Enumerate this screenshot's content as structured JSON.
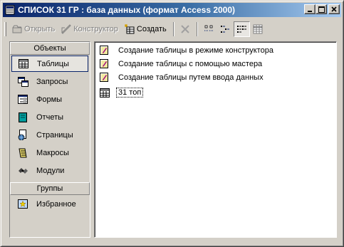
{
  "window": {
    "title": "СПИСОК 31 ГР : база данных (формат Access 2000)"
  },
  "toolbar": {
    "open_label": "Открыть",
    "design_label": "Конструктор",
    "create_label": "Создать"
  },
  "sidebar": {
    "objects_header": "Объекты",
    "items": [
      {
        "label": "Таблицы",
        "icon": "table-icon",
        "selected": true
      },
      {
        "label": "Запросы",
        "icon": "query-icon"
      },
      {
        "label": "Формы",
        "icon": "form-icon"
      },
      {
        "label": "Отчеты",
        "icon": "report-icon"
      },
      {
        "label": "Страницы",
        "icon": "page-icon"
      },
      {
        "label": "Макросы",
        "icon": "macro-icon"
      },
      {
        "label": "Модули",
        "icon": "module-icon"
      }
    ],
    "groups_header": "Группы",
    "group_items": [
      {
        "label": "Избранное",
        "icon": "favorites-icon"
      }
    ]
  },
  "list": {
    "items": [
      {
        "label": "Создание таблицы в режиме конструктора",
        "icon": "design-shortcut-icon"
      },
      {
        "label": "Создание таблицы с помощью мастера",
        "icon": "wizard-shortcut-icon"
      },
      {
        "label": "Создание таблицы путем ввода данных",
        "icon": "datasheet-shortcut-icon"
      },
      {
        "label": "31 топ",
        "icon": "table-icon"
      }
    ]
  },
  "colors": {
    "title_gradient_start": "#0a246a",
    "title_gradient_end": "#a6caf0",
    "face": "#d4d0c8"
  }
}
